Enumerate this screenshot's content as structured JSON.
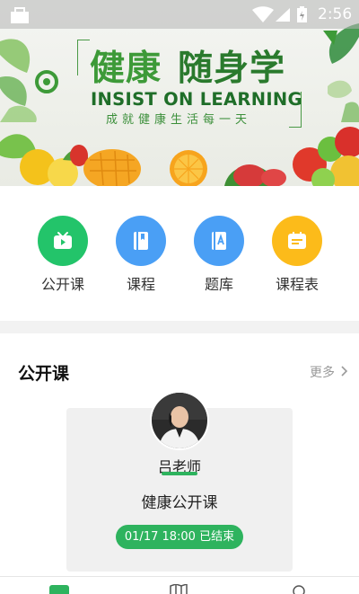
{
  "status_bar": {
    "time": "2:56",
    "app_icon": "shopping-bag-icon",
    "wifi_icon": "wifi-icon",
    "signal_icon": "signal-icon",
    "battery_icon": "battery-icon"
  },
  "banner": {
    "title_part1": "健康",
    "title_part2": "随身学",
    "title_en": "INSIST ON LEARNING",
    "subtitle": "成就健康生活每一天"
  },
  "nav": {
    "items": [
      {
        "label": "公开课",
        "icon": "tv-icon",
        "color": "#23c46a"
      },
      {
        "label": "课程",
        "icon": "book-icon",
        "color": "#4a9ff5"
      },
      {
        "label": "题库",
        "icon": "question-bank-icon",
        "color": "#4a9ff5"
      },
      {
        "label": "课程表",
        "icon": "schedule-icon",
        "color": "#fcbb1a"
      }
    ]
  },
  "public_courses": {
    "title": "公开课",
    "more_label": "更多",
    "card": {
      "teacher": "吕老师",
      "course_title": "健康公开课",
      "status": "01/17 18:00  已结束"
    }
  },
  "colors": {
    "accent": "#2eb35e",
    "banner_green": "#3d9a38"
  }
}
